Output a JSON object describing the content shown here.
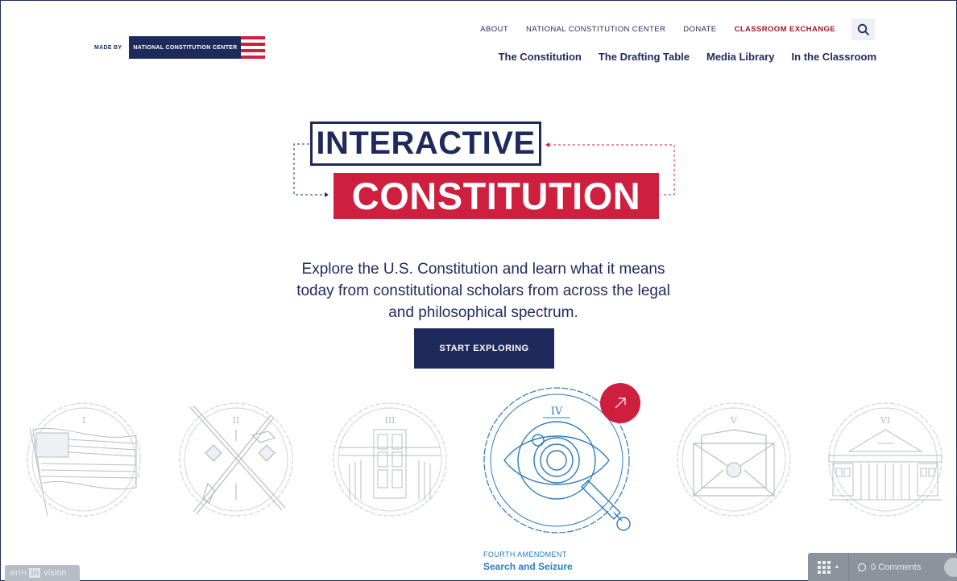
{
  "brand": {
    "made_by": "MADE BY",
    "org_name": "NATIONAL CONSTITUTION CENTER",
    "colors": {
      "navy": "#1f2a5c",
      "red": "#cf1f3e",
      "accent_link": "#9c1a2c",
      "amendment_blue": "#2b7bbf"
    }
  },
  "top_nav": {
    "items": [
      "ABOUT",
      "NATIONAL CONSTITUTION CENTER",
      "DONATE",
      "CLASSROOM EXCHANGE"
    ],
    "search_icon": "search-icon"
  },
  "main_nav": {
    "items": [
      "The Constitution",
      "The Drafting Table",
      "Media Library",
      "In the Classroom"
    ]
  },
  "hero": {
    "title_line1": "INTERACTIVE",
    "title_line2": "CONSTITUTION",
    "tagline": "Explore the U.S. Constitution and learn what it means today from constitutional scholars from across the legal and philosophical spectrum.",
    "cta_label": "START EXPLORING"
  },
  "amendments": {
    "seals": [
      {
        "numeral": "I",
        "icon": "flag-icon"
      },
      {
        "numeral": "II",
        "icon": "muskets-icon"
      },
      {
        "numeral": "III",
        "icon": "house-door-icon"
      },
      {
        "numeral": "IV",
        "icon": "eye-magnifier-icon"
      },
      {
        "numeral": "V",
        "icon": "envelope-shield-icon"
      },
      {
        "numeral": "VI",
        "icon": "courthouse-icon"
      }
    ],
    "featured": {
      "kicker": "FOURTH AMENDMENT",
      "title": "Search and Seizure",
      "badge_icon": "arrow-up-right-icon"
    }
  },
  "invision": {
    "badge_prefix": "WITH",
    "badge_in": "in",
    "badge_vision": "vision",
    "comments_label": "0 Comments"
  }
}
